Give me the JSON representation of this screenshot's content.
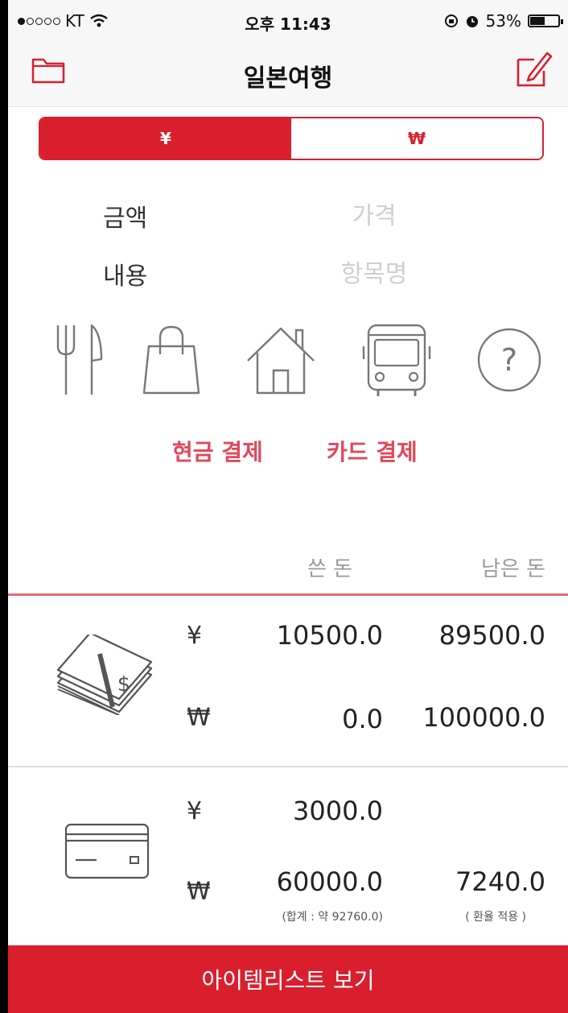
{
  "status_bar": {
    "carrier": "KT",
    "time": "오후 11:43",
    "battery": "53%",
    "battery_level": 0.53
  },
  "nav": {
    "title": "일본여행",
    "left_icon": "folder-icon",
    "right_icon": "compose-icon"
  },
  "currency_toggle": {
    "left": "¥",
    "right": "₩",
    "selected": "¥"
  },
  "form": {
    "amount_label": "금액",
    "amount_placeholder": "가격",
    "content_label": "내용",
    "content_placeholder": "항목명"
  },
  "categories": [
    {
      "icon": "fork-knife-icon"
    },
    {
      "icon": "shopping-bag-icon"
    },
    {
      "icon": "house-icon"
    },
    {
      "icon": "bus-icon"
    },
    {
      "icon": "question-icon"
    }
  ],
  "payment": {
    "cash": "현금 결제",
    "card": "카드 결제"
  },
  "summary": {
    "spent_header": "쓴 돈",
    "remaining_header": "남은 돈",
    "cash": {
      "icon": "cash-stack-icon",
      "yen_symbol": "¥",
      "won_symbol": "₩",
      "yen_spent": "10500.0",
      "yen_remaining": "89500.0",
      "won_spent": "0.0",
      "won_remaining": "100000.0"
    },
    "card": {
      "icon": "credit-card-icon",
      "yen_symbol": "¥",
      "won_symbol": "₩",
      "yen_spent": "3000.0",
      "won_spent": "60000.0",
      "won_remaining": "7240.0",
      "total_note": "(합계 : 약 92760.0)",
      "rate_note": "( 환율 적용 )"
    }
  },
  "bottom_button": "아이템리스트 보기",
  "colors": {
    "accent": "#d91f2e",
    "accent_light": "#e0485a"
  }
}
